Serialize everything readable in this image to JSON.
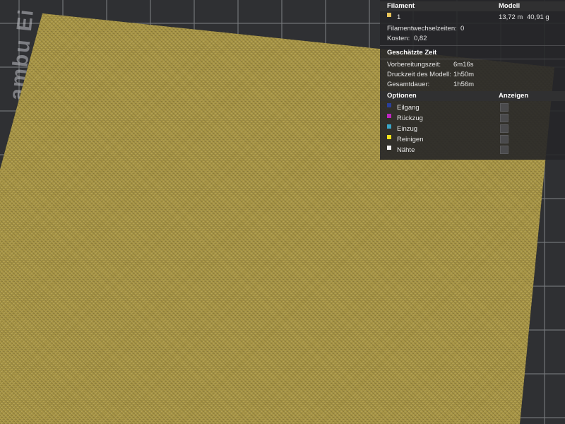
{
  "bed": {
    "label": "ambu Ei"
  },
  "panel": {
    "filament_header": "Filament",
    "model_header": "Modell",
    "filament_row": {
      "index": "1",
      "length": "13,72 m",
      "weight": "40,91 g",
      "color": "#e8c45a"
    },
    "filament_changes_label": "Filamentwechselzeiten:",
    "filament_changes_value": "0",
    "cost_label": "Kosten:",
    "cost_value": "0,82",
    "time_header": "Geschätzte Zeit",
    "prep_label": "Vorbereitungszeit:",
    "prep_value": "6m16s",
    "print_label": "Druckzeit des Modell:",
    "print_value": "1h50m",
    "total_label": "Gesamtdauer:",
    "total_value": "1h56m",
    "options_header": "Optionen",
    "show_header": "Anzeigen",
    "options": [
      {
        "label": "Eilgang",
        "color": "#2a3f9a",
        "icon": "travel-swatch"
      },
      {
        "label": "Rückzug",
        "color": "#c026c0",
        "icon": "retract-swatch"
      },
      {
        "label": "Einzug",
        "color": "#3aa6c8",
        "icon": "unretract-swatch"
      },
      {
        "label": "Reinigen",
        "color": "#f2e21c",
        "icon": "wipe-swatch"
      },
      {
        "label": "Nähte",
        "color": "#f2f2f2",
        "icon": "seam-swatch"
      }
    ]
  }
}
